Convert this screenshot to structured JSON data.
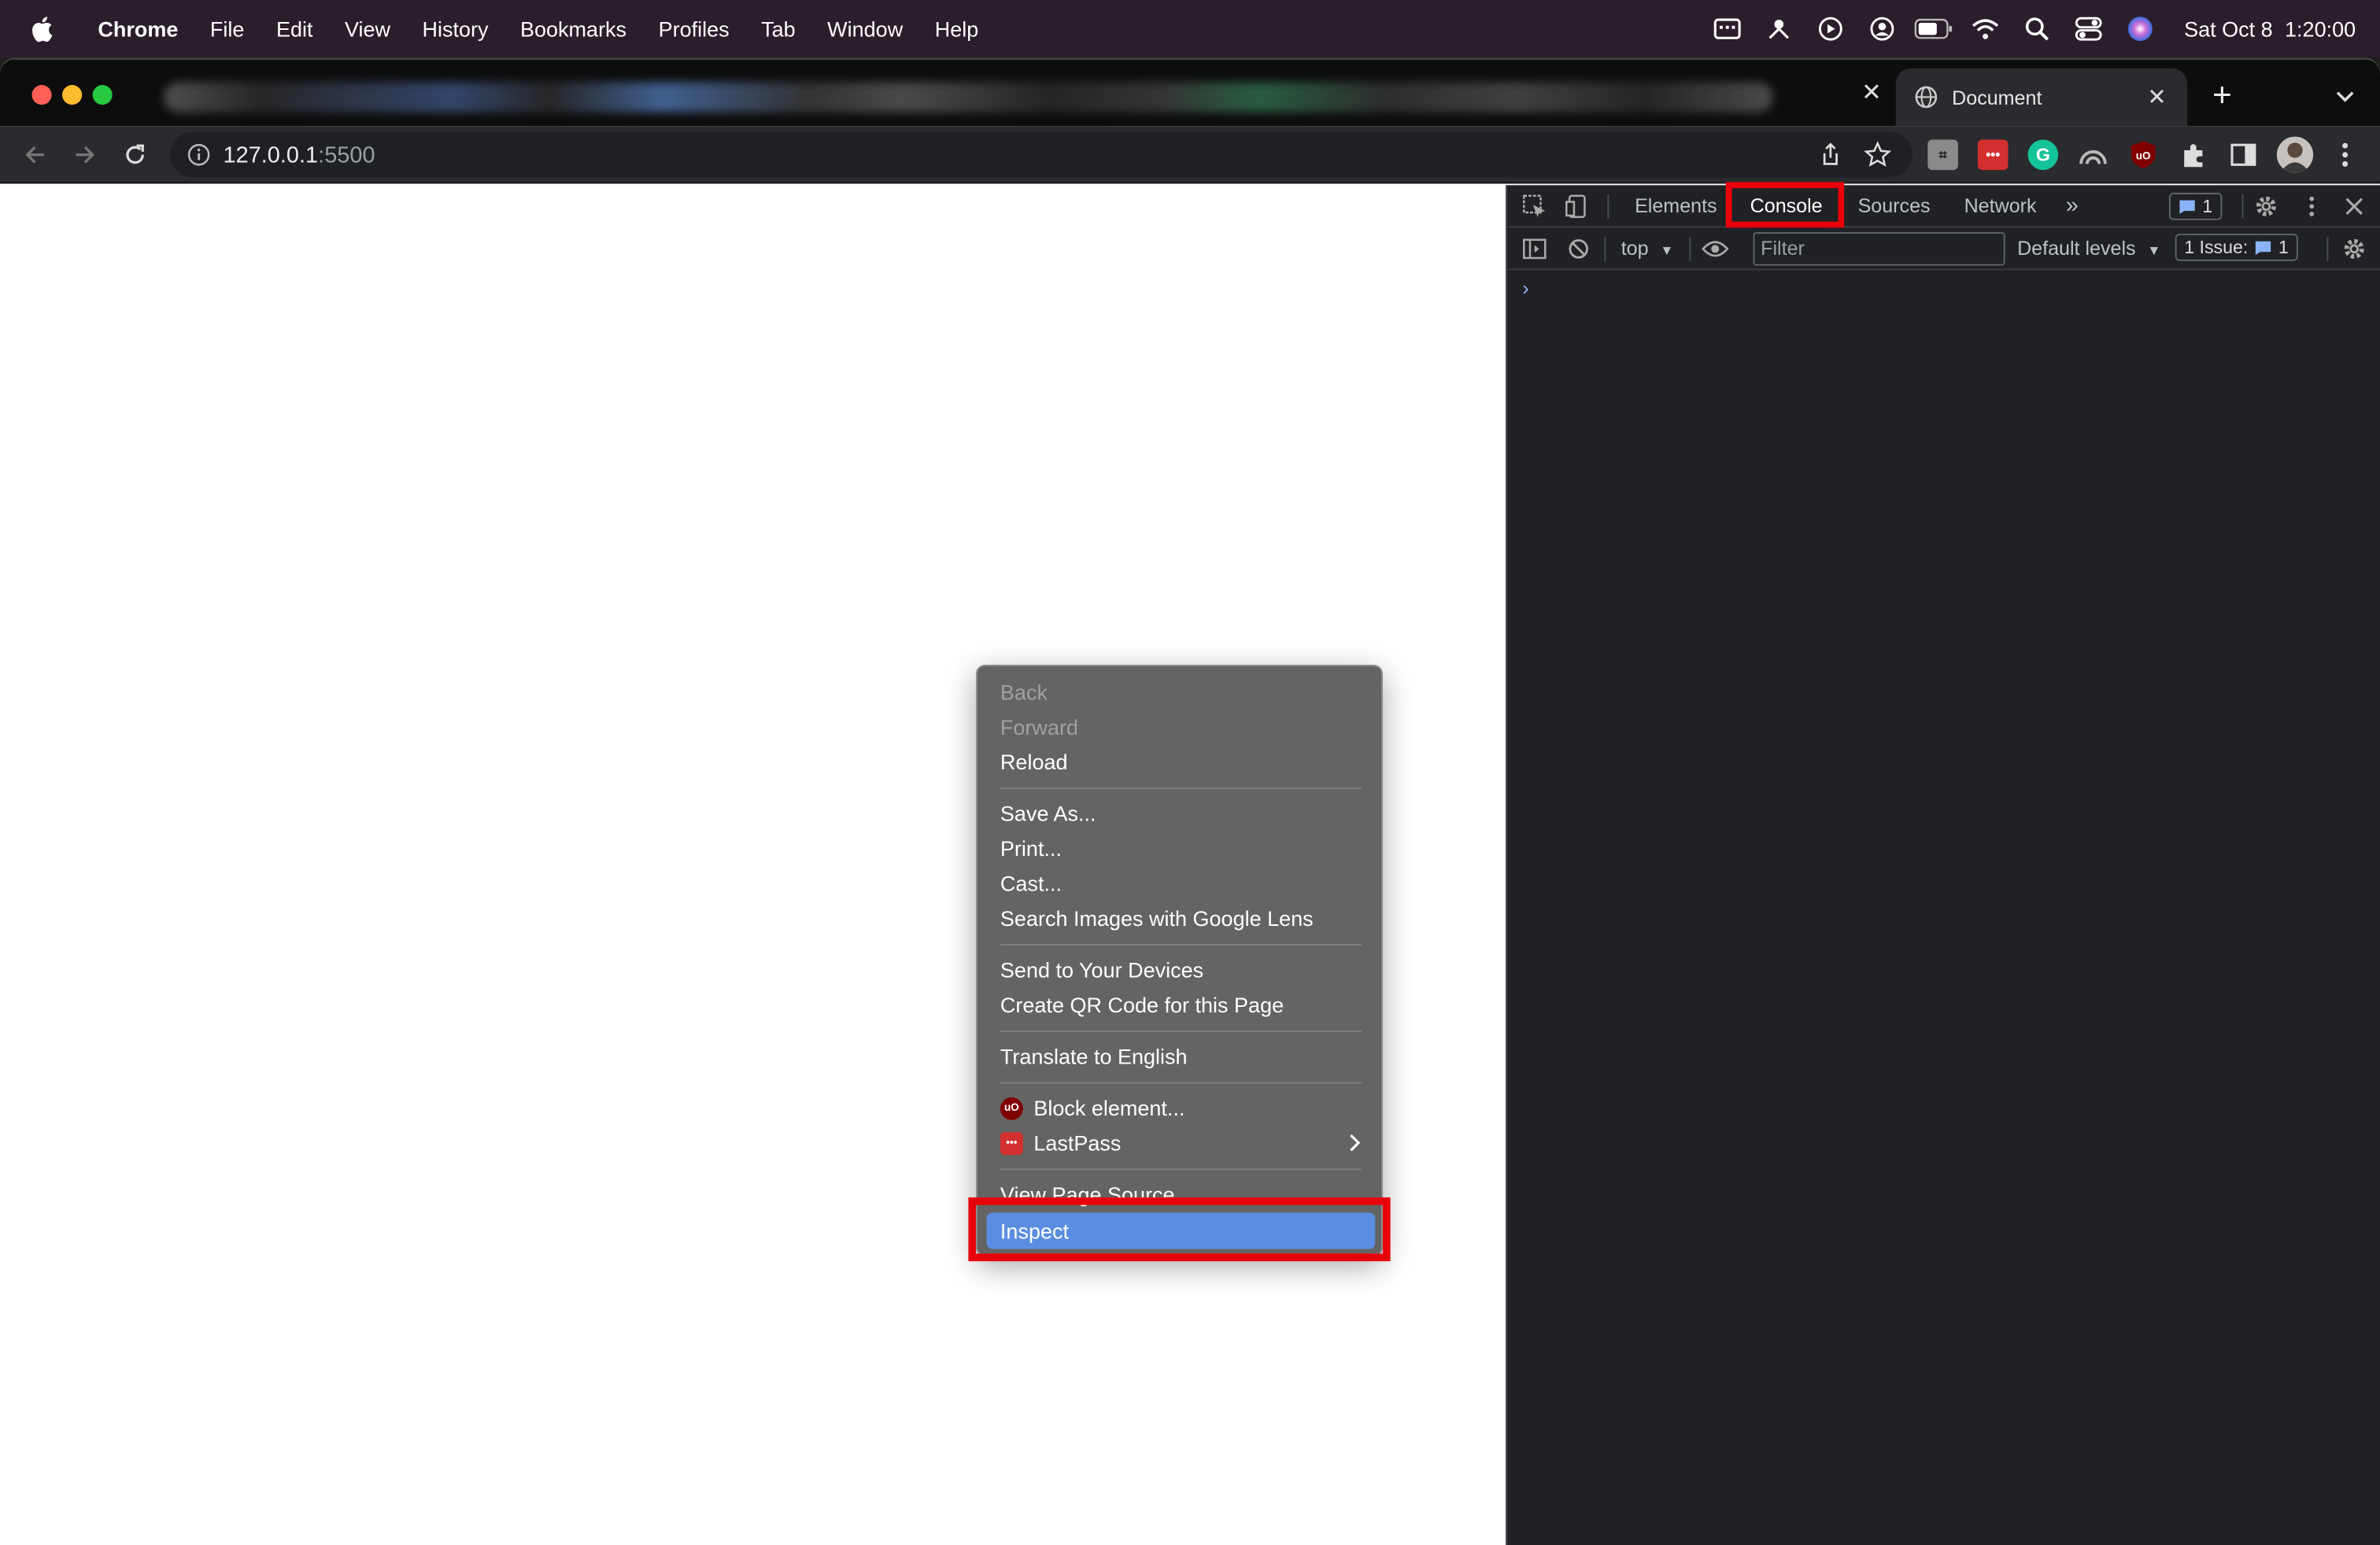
{
  "menubar": {
    "items": [
      "Chrome",
      "File",
      "Edit",
      "View",
      "History",
      "Bookmarks",
      "Profiles",
      "Tab",
      "Window",
      "Help"
    ],
    "status_icons": [
      "calendar-icon",
      "airdrop-icon",
      "play-icon",
      "user-icon",
      "battery-icon",
      "wifi-icon",
      "search-icon",
      "control-center-icon",
      "siri-icon"
    ],
    "date": "Sat Oct 8",
    "time": "1:20:00"
  },
  "browser": {
    "active_tab_title": "Document",
    "url_host": "127.0.0.1",
    "url_port": ":5500",
    "extensions": [
      "lastpass-ext-icon",
      "grammarly-icon",
      "ublock-origin-icon",
      "puzzle-icon",
      "side-panel-icon",
      "avatar",
      "more-icon"
    ]
  },
  "devtools": {
    "tabs": [
      "Elements",
      "Console",
      "Sources",
      "Network"
    ],
    "active_tab": "Console",
    "messages_badge": "1",
    "context": "top",
    "filter_placeholder": "Filter",
    "levels": "Default levels",
    "issues_label": "1 Issue:",
    "issues_count": "1",
    "prompt": "›"
  },
  "context_menu": {
    "items": [
      {
        "label": "Back",
        "enabled": false
      },
      {
        "label": "Forward",
        "enabled": false
      },
      {
        "label": "Reload",
        "enabled": true
      },
      {
        "label": "Save As...",
        "enabled": true
      },
      {
        "label": "Print...",
        "enabled": true
      },
      {
        "label": "Cast...",
        "enabled": true
      },
      {
        "label": "Search Images with Google Lens",
        "enabled": true
      },
      {
        "label": "Send to Your Devices",
        "enabled": true
      },
      {
        "label": "Create QR Code for this Page",
        "enabled": true
      },
      {
        "label": "Translate to English",
        "enabled": true
      },
      {
        "label": "Block element...",
        "enabled": true,
        "icon": "ublock-origin-icon"
      },
      {
        "label": "LastPass",
        "enabled": true,
        "icon": "lastpass-icon",
        "submenu": true
      },
      {
        "label": "View Page Source",
        "enabled": true
      },
      {
        "label": "Inspect",
        "enabled": true,
        "highlighted": true
      }
    ]
  },
  "colors": {
    "highlight_box": "#e8000b",
    "menu_highlight": "#5b8ee0",
    "link_blue": "#8ab4f8"
  }
}
